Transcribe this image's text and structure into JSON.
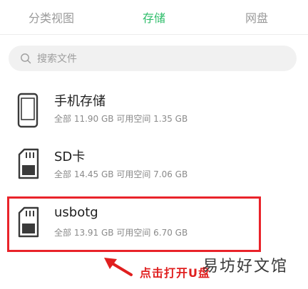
{
  "tabs": [
    {
      "label": "分类视图",
      "active": false
    },
    {
      "label": "存储",
      "active": true
    },
    {
      "label": "网盘",
      "active": false
    }
  ],
  "search": {
    "placeholder": "搜索文件"
  },
  "storage": [
    {
      "name": "手机存储",
      "detail": "全部 11.90 GB 可用空间 1.35 GB",
      "icon": "phone-icon"
    },
    {
      "name": "SD卡",
      "detail": "全部 14.45 GB 可用空间 7.06 GB",
      "icon": "sd-card-icon"
    },
    {
      "name": "usbotg",
      "detail": "全部 13.91 GB 可用空间 6.70 GB",
      "icon": "sd-card-icon"
    }
  ],
  "annotation": {
    "text": "点击打开U盘"
  },
  "watermark": {
    "text": "易坊好文馆"
  },
  "colors": {
    "accent": "#2ebd6a",
    "highlight": "#e9232a"
  }
}
